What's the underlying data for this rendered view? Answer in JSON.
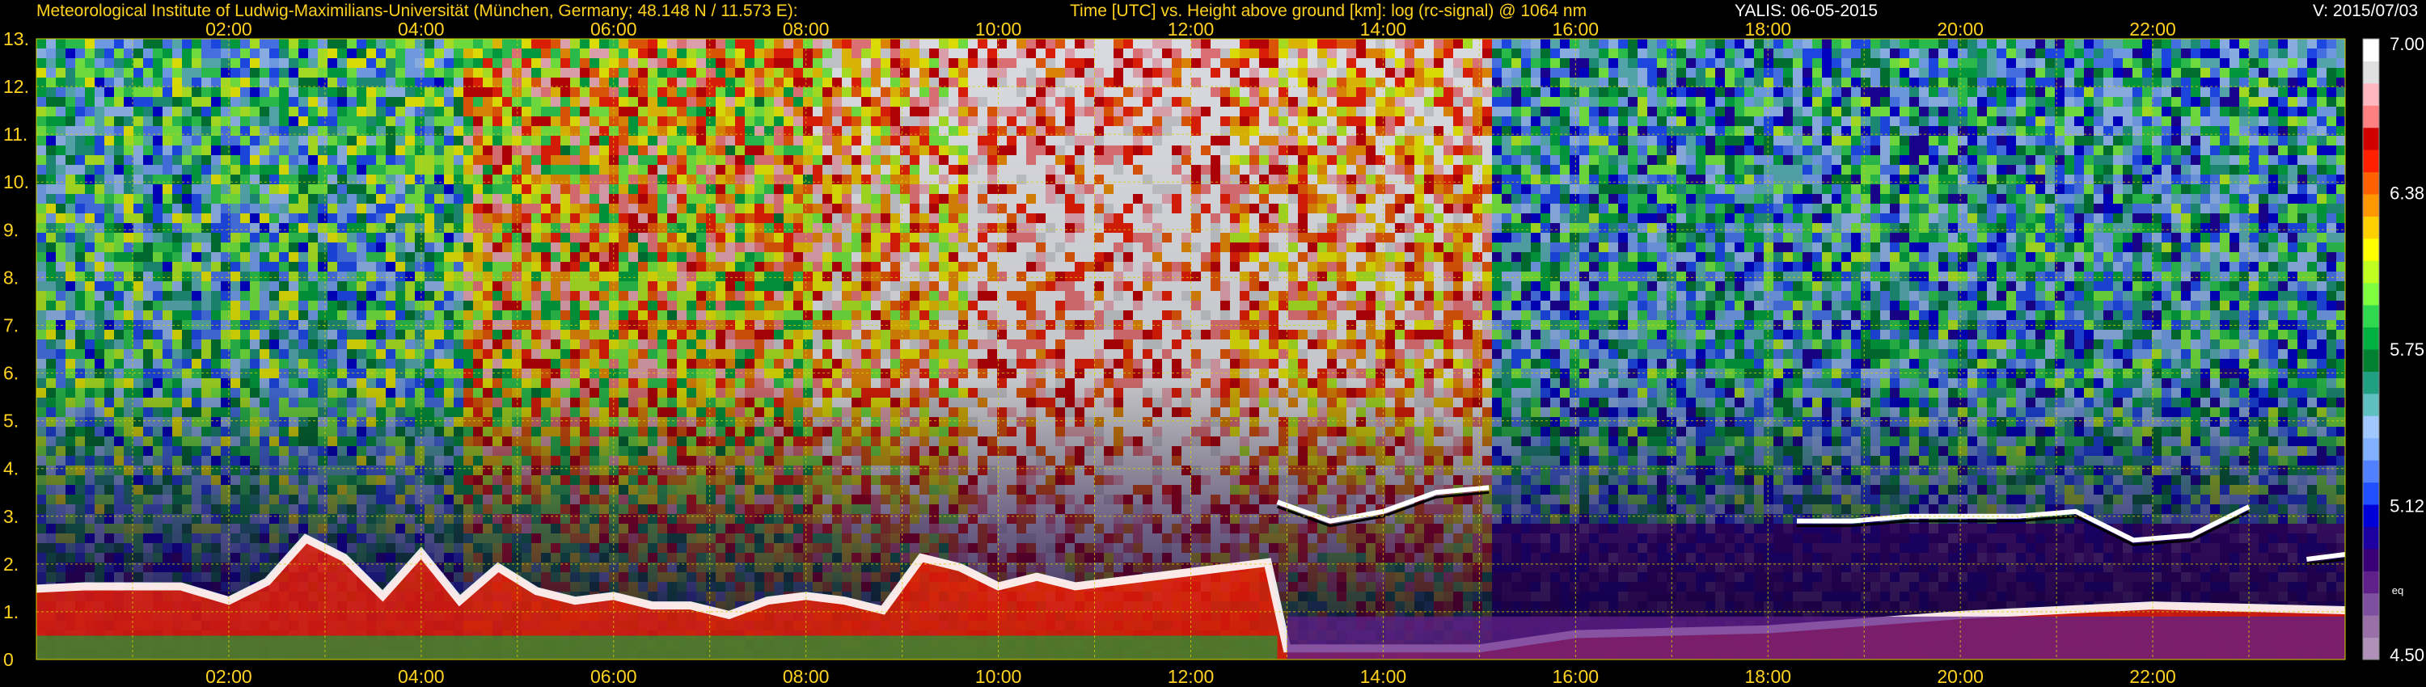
{
  "header": {
    "institute": "Meteorological Institute of Ludwig-Maximilians-Universität (München, Germany; 48.148 N / 11.573 E):",
    "description": "Time [UTC] vs. Height above ground [km]: log (rc-signal) @ 1064 nm",
    "instrument": "YALIS: 06-05-2015",
    "version": "V: 2015/07/03"
  },
  "colors": {
    "text": "#ffd21f",
    "grid": "#d8d000",
    "background": "#000000",
    "colorbar_text": "#ffffff"
  },
  "chart_data": {
    "type": "heatmap",
    "x_unit": "UTC hour",
    "xlim": [
      0,
      24
    ],
    "ylim": [
      0,
      13
    ],
    "x_tick_labels": [
      {
        "value": 2,
        "label": "02:00"
      },
      {
        "value": 4,
        "label": "04:00"
      },
      {
        "value": 6,
        "label": "06:00"
      },
      {
        "value": 8,
        "label": "08:00"
      },
      {
        "value": 10,
        "label": "10:00"
      },
      {
        "value": 12,
        "label": "12:00"
      },
      {
        "value": 14,
        "label": "14:00"
      },
      {
        "value": 16,
        "label": "16:00"
      },
      {
        "value": 18,
        "label": "18:00"
      },
      {
        "value": 20,
        "label": "20:00"
      },
      {
        "value": 22,
        "label": "22:00"
      }
    ],
    "y_tick_labels": [
      "0",
      "1.",
      "2.",
      "3.",
      "4.",
      "5.",
      "6.",
      "7.",
      "8.",
      "9.",
      "10.",
      "11.",
      "12.",
      "13."
    ],
    "grid": true,
    "colorbar": {
      "min": 4.5,
      "max": 7.0,
      "tick_values": [
        4.5,
        5.12,
        5.75,
        6.38,
        7.0
      ],
      "tick_labels": [
        "4.50",
        "5.12",
        "5.75",
        "6.38",
        "7.00"
      ],
      "extra_label": "eq",
      "extra_value": 4.78,
      "colors": [
        "#b090b8",
        "#9a70a8",
        "#8050a0",
        "#60208a",
        "#3a0078",
        "#1c00a0",
        "#0000d8",
        "#2050ff",
        "#5080ff",
        "#80b0ff",
        "#a0c8ff",
        "#60c0c0",
        "#20a080",
        "#008030",
        "#00b040",
        "#30d850",
        "#80ff40",
        "#c0ff20",
        "#ffff00",
        "#ffd000",
        "#ff9800",
        "#ff6000",
        "#ff2000",
        "#d00000",
        "#ff8080",
        "#ffb8c0",
        "#e0e0e0",
        "#ffffff"
      ]
    },
    "aerosol_layer_top_km": [
      [
        0.0,
        1.55
      ],
      [
        0.5,
        1.6
      ],
      [
        1.0,
        1.6
      ],
      [
        1.5,
        1.6
      ],
      [
        2.0,
        1.3
      ],
      [
        2.4,
        1.7
      ],
      [
        2.8,
        2.6
      ],
      [
        3.2,
        2.2
      ],
      [
        3.6,
        1.4
      ],
      [
        4.0,
        2.3
      ],
      [
        4.4,
        1.3
      ],
      [
        4.8,
        2.0
      ],
      [
        5.2,
        1.5
      ],
      [
        5.6,
        1.3
      ],
      [
        6.0,
        1.4
      ],
      [
        6.4,
        1.2
      ],
      [
        6.8,
        1.2
      ],
      [
        7.2,
        1.0
      ],
      [
        7.6,
        1.3
      ],
      [
        8.0,
        1.4
      ],
      [
        8.4,
        1.3
      ],
      [
        8.8,
        1.1
      ],
      [
        9.2,
        2.2
      ],
      [
        9.6,
        2.0
      ],
      [
        10.0,
        1.6
      ],
      [
        10.4,
        1.8
      ],
      [
        10.8,
        1.6
      ],
      [
        11.2,
        1.7
      ],
      [
        11.6,
        1.8
      ],
      [
        12.0,
        1.9
      ],
      [
        12.4,
        2.0
      ],
      [
        12.8,
        2.1
      ],
      [
        13.0,
        0.3
      ],
      [
        14.0,
        0.3
      ],
      [
        15.0,
        0.3
      ],
      [
        16.0,
        0.6
      ],
      [
        18.0,
        0.7
      ],
      [
        20.0,
        1.0
      ],
      [
        22.0,
        1.2
      ],
      [
        24.0,
        1.1
      ]
    ],
    "cloud_layers_km": [
      {
        "from_hour": 12.9,
        "to_hour": 15.1,
        "height": [
          3.3,
          2.9,
          3.1,
          3.5,
          3.6
        ]
      },
      {
        "from_hour": 18.3,
        "to_hour": 20.6,
        "height": [
          2.9,
          2.9,
          3.0,
          3.0,
          3.0
        ]
      },
      {
        "from_hour": 20.6,
        "to_hour": 23.0,
        "height": [
          3.0,
          3.1,
          2.5,
          2.6,
          3.2
        ]
      },
      {
        "from_hour": 23.6,
        "to_hour": 24.0,
        "height": [
          2.1,
          2.2
        ]
      }
    ],
    "regions": [
      {
        "from_hour": 0.0,
        "to_hour": 4.4,
        "level": 0.45
      },
      {
        "from_hour": 4.4,
        "to_hour": 8.0,
        "level": 0.72
      },
      {
        "from_hour": 8.0,
        "to_hour": 9.6,
        "level": 0.8
      },
      {
        "from_hour": 9.6,
        "to_hour": 12.4,
        "level": 0.97
      },
      {
        "from_hour": 12.4,
        "to_hour": 15.1,
        "level": 0.85
      },
      {
        "from_hour": 15.1,
        "to_hour": 24.0,
        "level": 0.4
      }
    ]
  }
}
